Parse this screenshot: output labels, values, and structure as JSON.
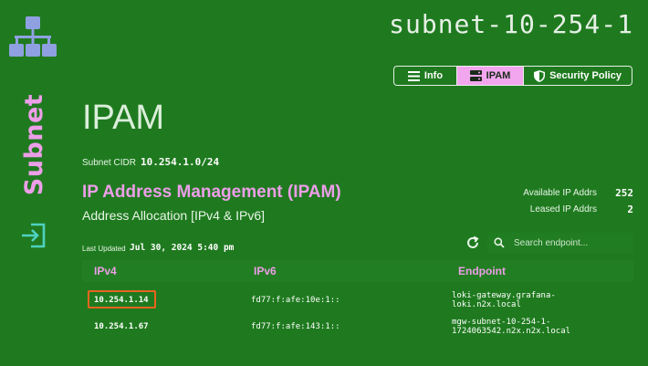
{
  "sidebar": {
    "section_label": "Subnet",
    "network_icon": "network-topology-icon",
    "exit_icon": "sign-in-icon"
  },
  "header": {
    "subnet_name": "subnet-10-254-1",
    "tabs": [
      {
        "label": "Info",
        "icon": "list-icon",
        "active": false
      },
      {
        "label": "IPAM",
        "icon": "server-icon",
        "active": true
      },
      {
        "label": "Security Policy",
        "icon": "shield-icon",
        "active": false
      }
    ]
  },
  "page": {
    "title": "IPAM",
    "cidr_label": "Subnet CIDR",
    "cidr_value": "10.254.1.0/24",
    "section_title": "IP Address Management (IPAM)",
    "section_subtitle": "Address Allocation [IPv4 & IPv6]",
    "available_label": "Available IP Addrs",
    "available_value": "252",
    "leased_label": "Leased IP Addrs",
    "leased_value": "2",
    "updated_label": "Last Updated",
    "updated_value": "Jul 30, 2024 5:40 pm",
    "search_placeholder": "Search endpoint..."
  },
  "table": {
    "columns": [
      "IPv4",
      "IPv6",
      "Endpoint"
    ],
    "rows": [
      {
        "ipv4": "10.254.1.14",
        "ipv6": "fd77:f:afe:10e:1::",
        "endpoint_1": "loki-gateway.grafana-",
        "endpoint_2": "loki.n2x.local",
        "selected": true
      },
      {
        "ipv4": "10.254.1.67",
        "ipv6": "fd77:f:afe:143:1::",
        "endpoint_1": "mgw-subnet-10-254-1-",
        "endpoint_2": "1724063542.n2x.n2x.local",
        "selected": false
      }
    ]
  },
  "colors": {
    "background": "#1f7a1f",
    "accent_pink": "#ec9ee8",
    "selection": "#e8641e",
    "icon_blue": "#8fa0e0",
    "exit_teal": "#4fd1c0"
  }
}
